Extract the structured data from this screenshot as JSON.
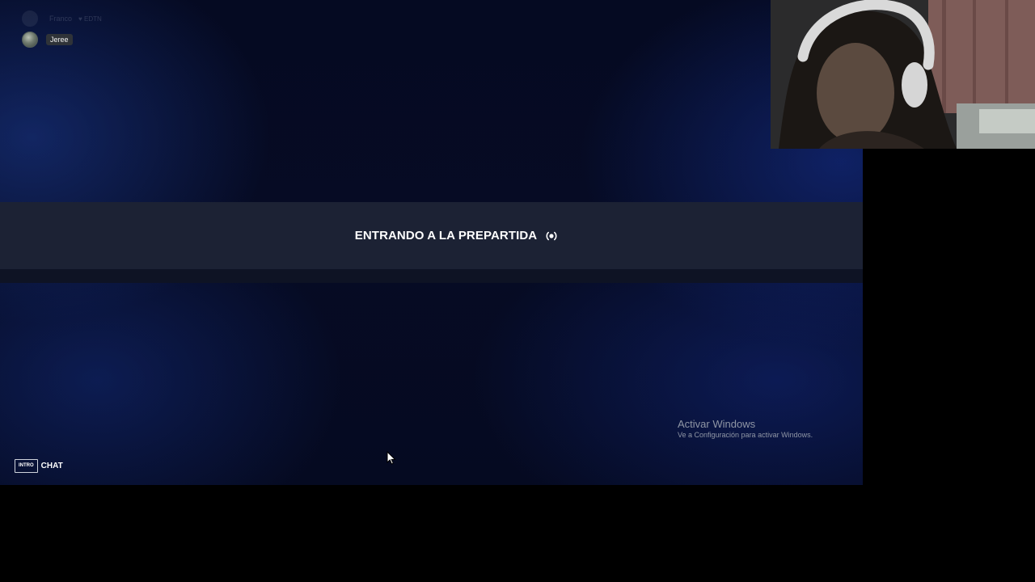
{
  "party": {
    "players": [
      {
        "name": "Franco",
        "tag": "EDTN"
      },
      {
        "name": "Jeree"
      }
    ]
  },
  "status": {
    "message": "ENTRANDO A LA PREPARTIDA"
  },
  "chat_hint": {
    "key": "INTRO",
    "label": "CHAT"
  },
  "watermark": {
    "title": "Activar Windows",
    "subtitle": "Ve a Configuración para activar Windows."
  },
  "colors": {
    "banner": "#1c2234",
    "background": "#060b24",
    "accent_text": "#ffffff"
  },
  "icons": {
    "loading": "broadcast-loading-icon",
    "cursor": "mouse-pointer-icon"
  }
}
